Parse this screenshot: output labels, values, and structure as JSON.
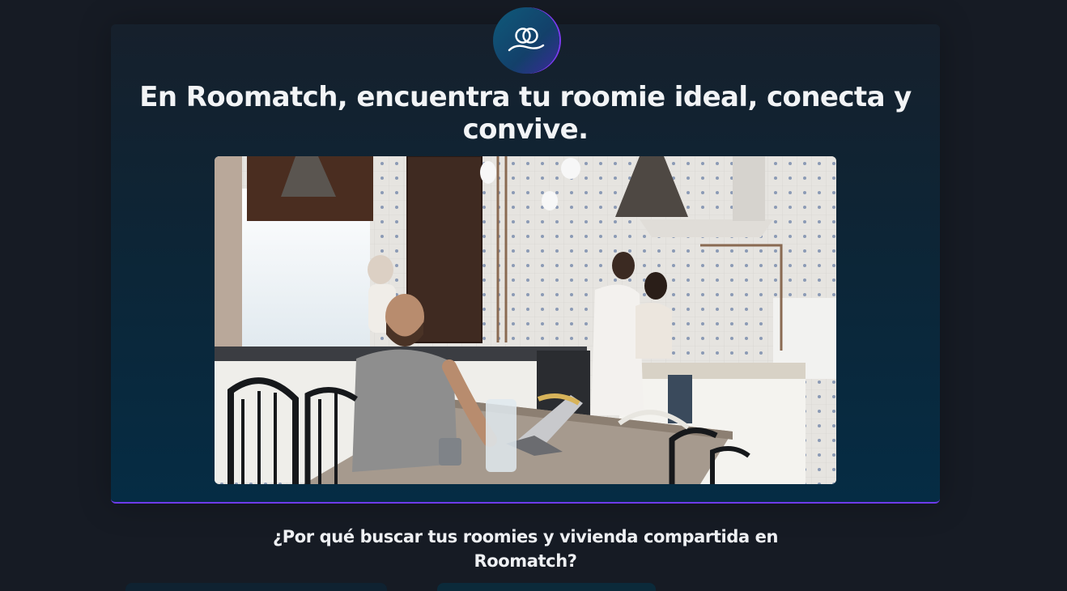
{
  "hero": {
    "logo_icon": "roommates-icon",
    "title": "En Roomatch, encuentra tu roomie ideal, conecta y convive.",
    "image_alt": "Personas compartiendo una cocina"
  },
  "features": {
    "title": "¿Por qué buscar tus roomies y vivienda compartida en Roomatch?"
  },
  "colors": {
    "background": "#161b24",
    "card_accent": "#6d3bea",
    "card_bottom": "#052c44"
  }
}
